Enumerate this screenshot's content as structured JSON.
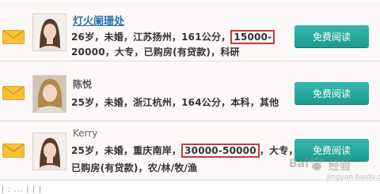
{
  "profiles": [
    {
      "name": "灯火阑珊处",
      "details_line1_prefix": "26岁，未婚，江苏扬州，161公分，",
      "details_line1_highlight": "15000-",
      "details_line2": "20000，大专，已购房(有贷款)，科研",
      "button_label": "免费阅读"
    },
    {
      "name": "陈悦",
      "details_line1": "25岁，未婚，浙江杭州，164公分，本科，其他",
      "button_label": "免费阅读"
    },
    {
      "name": "Kerry",
      "details_line1_prefix": "25岁，未婚，重庆南岸，",
      "details_line1_highlight": "30000-50000",
      "details_line1_suffix": "，大专，",
      "details_line2": "已购房(有贷款)，农/林/牧/渔",
      "button_label": "免费阅读"
    }
  ],
  "footer_text": "| : ... | | |",
  "watermark": {
    "brand_left": "Bai",
    "brand_right": "经验",
    "url": "jingyan.baidu.com"
  },
  "colors": {
    "button": "#23a79b",
    "link": "#2a6fb0",
    "highlight_box": "#c93a3a",
    "mail_icon": "#f6c23a"
  }
}
